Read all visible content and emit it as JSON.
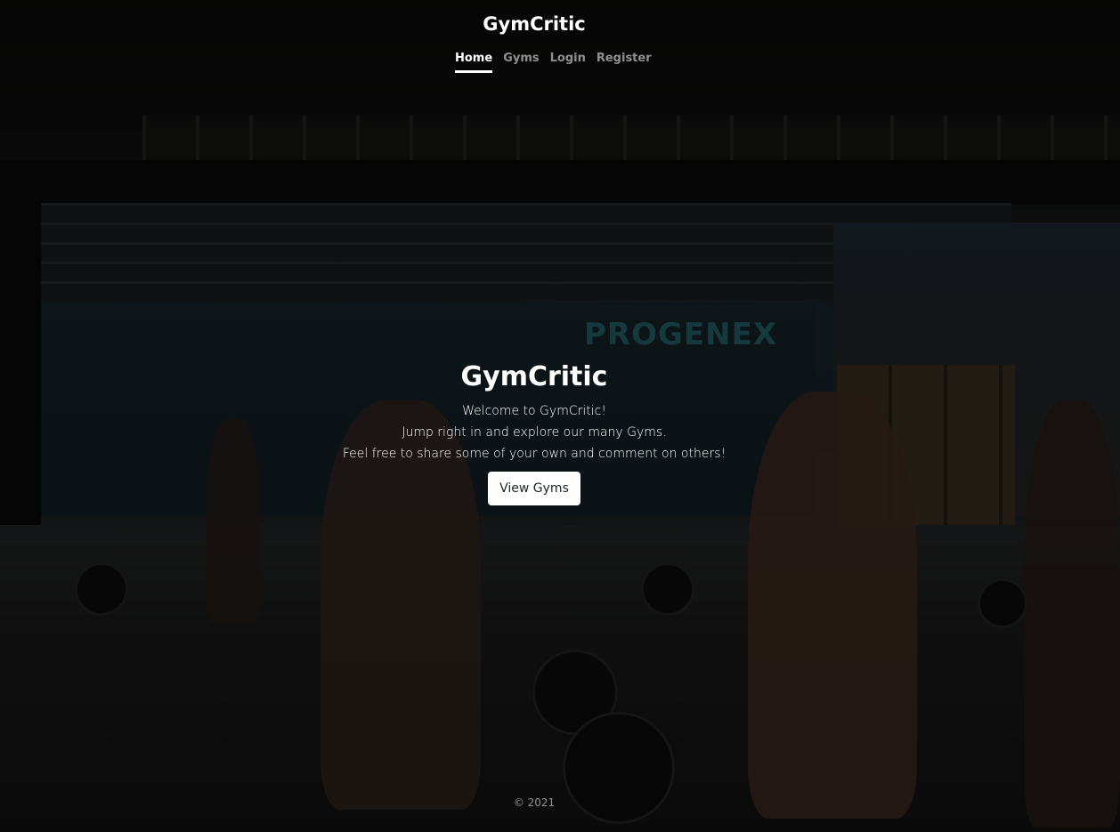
{
  "header": {
    "brand": "GymCritic",
    "nav": [
      {
        "label": "Home",
        "active": true
      },
      {
        "label": "Gyms",
        "active": false
      },
      {
        "label": "Login",
        "active": false
      },
      {
        "label": "Register",
        "active": false
      }
    ]
  },
  "hero": {
    "title": "GymCritic",
    "lines": [
      "Welcome to GymCritic!",
      "Jump right in and explore our many Gyms.",
      "Feel free to share some of your own and comment on others!"
    ],
    "button_label": "View Gyms"
  },
  "background": {
    "sign_text": "PROGENEX"
  },
  "footer": {
    "copyright": "© 2021"
  }
}
